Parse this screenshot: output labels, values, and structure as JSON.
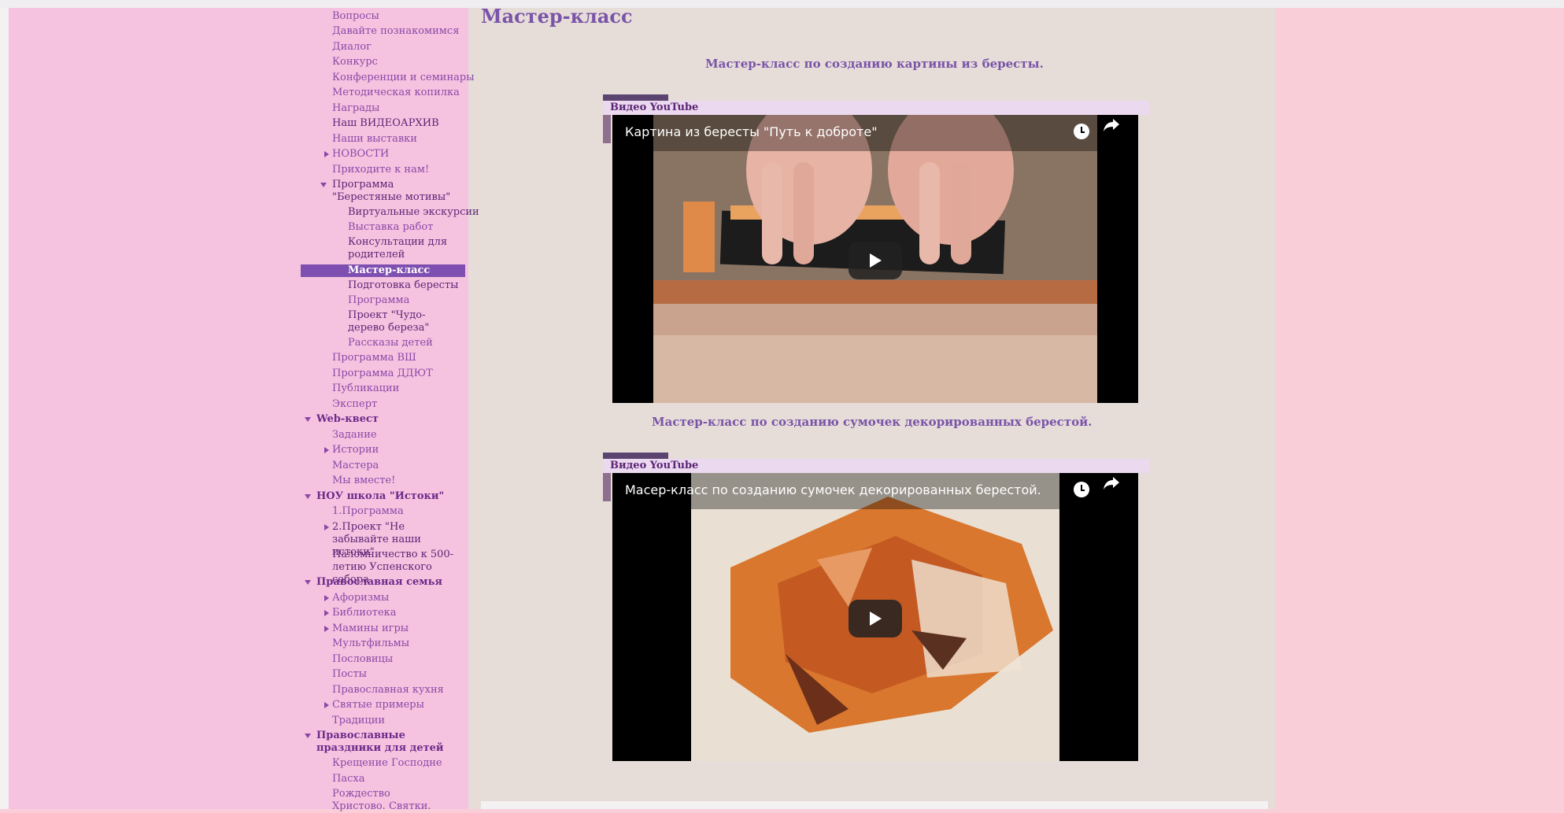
{
  "page": {
    "title": "Мастер-класс"
  },
  "colors": {
    "page_background": "#f9ced9",
    "sidebar_background": "#f5c3e0",
    "content_background": "#e6ddd8",
    "accent": "#7a54a8",
    "active_item": "#7e4fb0",
    "link": "#8a48a6"
  },
  "sidebar": {
    "items": [
      {
        "label": "Вопросы"
      },
      {
        "label": "Давайте познакомимся"
      },
      {
        "label": "Диалог"
      },
      {
        "label": "Конкурс"
      },
      {
        "label": "Конференции и семинары"
      },
      {
        "label": "Методическая копилка"
      },
      {
        "label": "Награды"
      },
      {
        "label": "Наш ВИДЕОАРХИВ"
      },
      {
        "label": "Наши выставки"
      },
      {
        "label": "НОВОСТИ",
        "expander": "collapsed"
      },
      {
        "label": "Приходите к нам!"
      },
      {
        "label": "Программа \"Берестяные мотивы\"",
        "expander": "expanded"
      },
      {
        "label": "Виртуальные экскурсии"
      },
      {
        "label": "Выставка работ"
      },
      {
        "label": "Консультации для родителей"
      },
      {
        "label": "Мастер-класс",
        "active": true
      },
      {
        "label": "Подготовка бересты"
      },
      {
        "label": "Программа"
      },
      {
        "label": "Проект \"Чудо-дерево береза\""
      },
      {
        "label": "Рассказы детей"
      },
      {
        "label": "Программа ВШ"
      },
      {
        "label": "Программа ДДЮТ"
      },
      {
        "label": "Публикации"
      },
      {
        "label": "Эксперт"
      },
      {
        "label": "Web-квест",
        "expander": "expanded"
      },
      {
        "label": "Задание"
      },
      {
        "label": "Истории",
        "expander": "collapsed"
      },
      {
        "label": "Мастера"
      },
      {
        "label": "Мы вместе!"
      },
      {
        "label": "НОУ школа \"Истоки\"",
        "expander": "expanded"
      },
      {
        "label": "1.Программа"
      },
      {
        "label": "2.Проект \"Не забывайте наши истоки\"",
        "expander": "collapsed"
      },
      {
        "label": "Паломничество к 500-летию Успенского собора"
      },
      {
        "label": "Православная семья",
        "expander": "expanded"
      },
      {
        "label": "Афоризмы",
        "expander": "collapsed"
      },
      {
        "label": "Библиотека",
        "expander": "collapsed"
      },
      {
        "label": "Мамины игры",
        "expander": "collapsed"
      },
      {
        "label": "Мультфильмы"
      },
      {
        "label": "Пословицы"
      },
      {
        "label": "Посты"
      },
      {
        "label": "Православная кухня"
      },
      {
        "label": "Святые примеры",
        "expander": "collapsed"
      },
      {
        "label": "Традиции"
      },
      {
        "label": "Православные праздники для детей",
        "expander": "expanded"
      },
      {
        "label": "Крещение Господне"
      },
      {
        "label": "Пасха"
      },
      {
        "label": "Рождество Христово. Святки."
      }
    ]
  },
  "videos": [
    {
      "heading": "Мастер-класс по созданию картины из бересты.",
      "source_label": "Видео YouTube",
      "title": "Картина из бересты \"Путь к доброте\"",
      "icons": [
        "watch-later-icon",
        "share-icon",
        "play-icon"
      ]
    },
    {
      "heading": "Мастер-класс по созданию сумочек декорированных берестой.",
      "source_label": "Видео YouTube",
      "title": "Масер-класс по созданию сумочек декорированных берестой.",
      "icons": [
        "watch-later-icon",
        "share-icon",
        "play-icon"
      ]
    }
  ]
}
